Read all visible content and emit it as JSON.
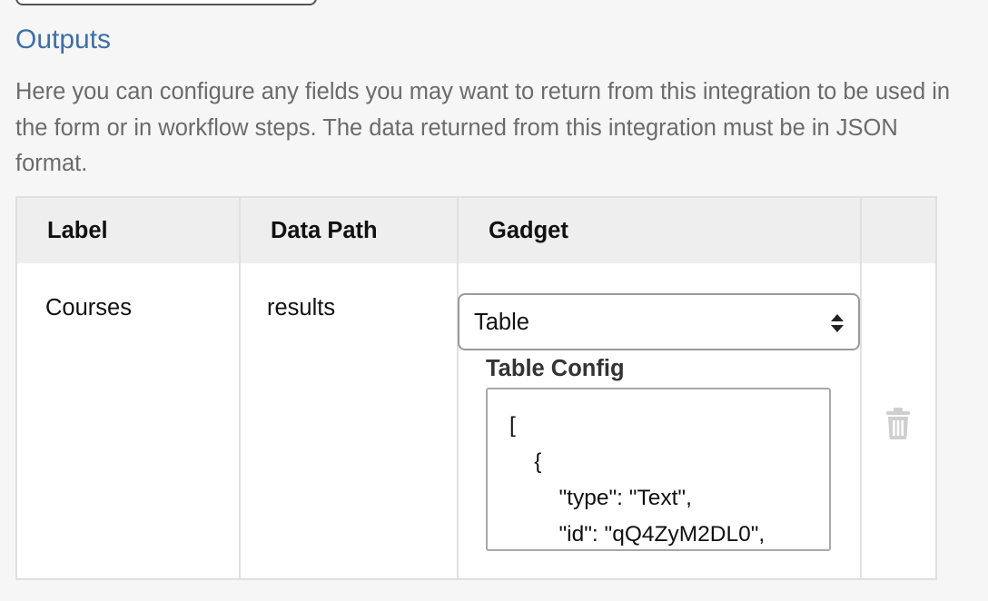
{
  "outputs": {
    "title": "Outputs",
    "description": "Here you can configure any fields you may want to return from this integration to be used in the form or in workflow steps.  The data returned from this integration must be in JSON format.",
    "table": {
      "headers": {
        "label": "Label",
        "data_path": "Data Path",
        "gadget": "Gadget"
      },
      "rows": [
        {
          "label": "Courses",
          "data_path": "results",
          "gadget": "Table",
          "config_label": "Table Config",
          "config_value": "[\n    {\n        \"type\": \"Text\",\n        \"id\": \"qQ4ZyM2DL0\","
        }
      ]
    }
  },
  "icons": {
    "select_arrows": "sort-arrows-icon",
    "delete": "trash-icon"
  },
  "colors": {
    "title": "#3f6fa4",
    "description": "#6b6b6b",
    "header_bg": "#eeeeee",
    "trash": "#cfcfcf"
  }
}
